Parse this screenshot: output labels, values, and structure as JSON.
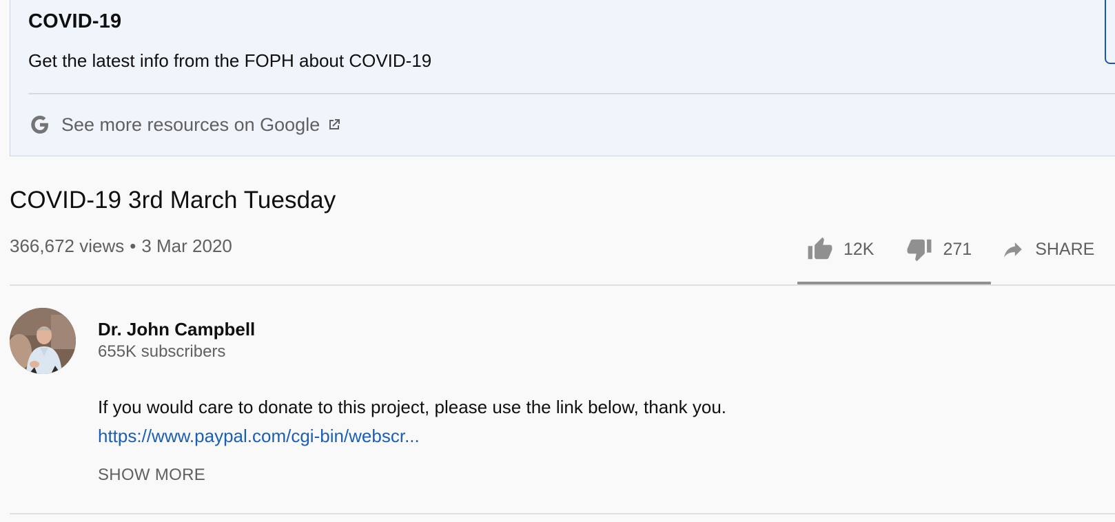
{
  "info_panel": {
    "title": "COVID-19",
    "text": "Get the latest info from the FOPH about COVID-19",
    "link_label": "See more resources on Google",
    "link_icon": "google-g-icon",
    "external_icon": "external-link-icon"
  },
  "video": {
    "title": "COVID-19 3rd March Tuesday",
    "views": "366,672 views",
    "separator": "•",
    "date": "3 Mar 2020"
  },
  "actions": {
    "like_count": "12K",
    "dislike_count": "271",
    "share_label": "SHARE",
    "like_ratio": 0.978
  },
  "channel": {
    "name": "Dr. John Campbell",
    "subscribers": "655K subscribers"
  },
  "description": {
    "text": "If you would care to donate to this project, please use the link below, thank you.",
    "link": "https://www.paypal.com/cgi-bin/webscr...",
    "show_more": "SHOW MORE"
  },
  "colors": {
    "panel_bg": "#f0f4fb",
    "link_blue": "#1a5fb4",
    "muted_gray": "#606060",
    "icon_gray": "#909090"
  }
}
